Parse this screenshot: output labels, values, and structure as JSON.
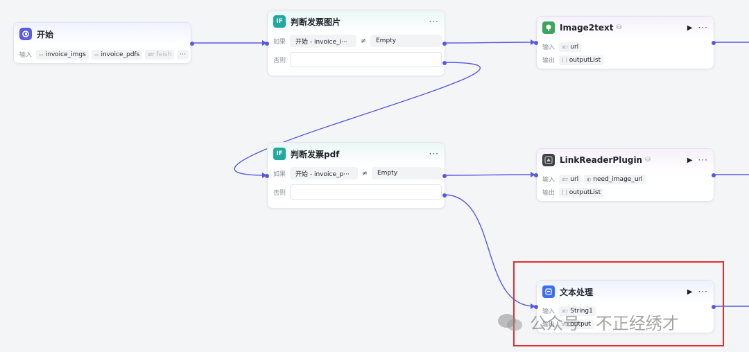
{
  "colors": {
    "edge": "#5858e0",
    "highlight": "#e02f2f",
    "condition_icon": "#1fa9a1",
    "start_icon": "#5b5ce2"
  },
  "start_node": {
    "title": "开始",
    "icon": "start-icon",
    "input_label": "输入",
    "inputs": [
      "invoice_imgs",
      "invoice_pdfs",
      "feish"
    ],
    "more": "···"
  },
  "cond_image": {
    "title": "判断发票图片",
    "icon_text": "IF",
    "more": "···",
    "if_label": "如果",
    "else_label": "否则",
    "left": "开始 - invoice_i···",
    "operator": "≠",
    "right": "Empty"
  },
  "cond_pdf": {
    "title": "判断发票pdf",
    "icon_text": "IF",
    "more": "···",
    "if_label": "如果",
    "else_label": "否则",
    "left": "开始 - invoice_p···",
    "operator": "≠",
    "right": "Empty"
  },
  "image2text": {
    "title": "Image2text",
    "run": "▶",
    "more": "···",
    "input_label": "输入",
    "output_label": "输出",
    "inputs": [
      "url"
    ],
    "outputs": [
      "outputList"
    ]
  },
  "linkreader": {
    "title": "LinkReaderPlugin",
    "run": "▶",
    "more": "···",
    "input_label": "输入",
    "output_label": "输出",
    "inputs": [
      "url",
      "need_image_url"
    ],
    "outputs": [
      "outputList"
    ]
  },
  "text_proc": {
    "title": "文本处理",
    "run": "▶",
    "more": "···",
    "input_label": "输入",
    "output_label": "输出",
    "inputs": [
      "String1"
    ],
    "outputs": [
      "output"
    ]
  },
  "watermark": {
    "text": "公众号 · 不正经绣才"
  }
}
